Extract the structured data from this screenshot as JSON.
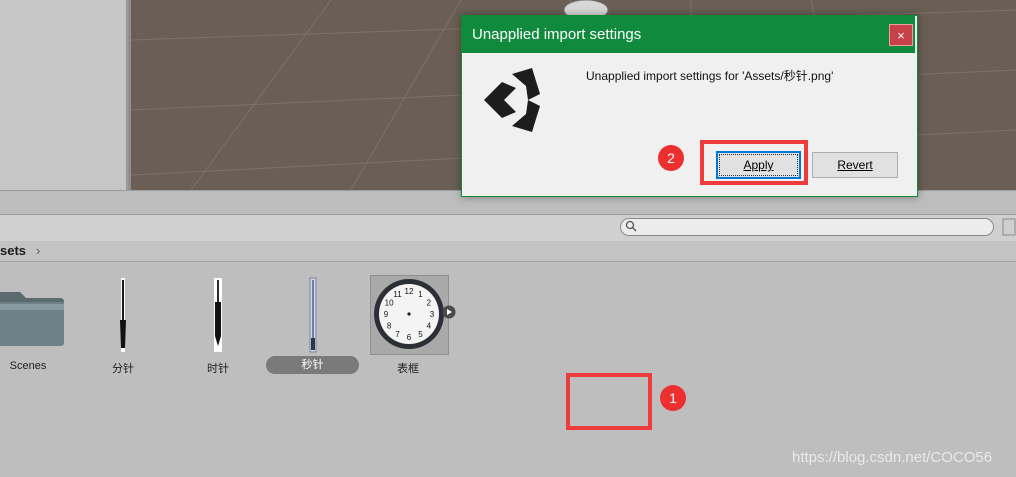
{
  "dialog": {
    "title": "Unapplied import settings",
    "close_glyph": "×",
    "message": "Unapplied import settings for 'Assets/秒针.png'",
    "apply_label": "Apply",
    "revert_label": "Revert"
  },
  "breadcrumb": {
    "text": "sets",
    "arrow": "›"
  },
  "assets": [
    {
      "label": "Scenes",
      "kind": "folder-icon"
    },
    {
      "label": "分针",
      "kind": "minute-hand"
    },
    {
      "label": "时针",
      "kind": "hour-hand"
    },
    {
      "label": "秒针",
      "kind": "second-hand",
      "selected": true
    },
    {
      "label": "表框",
      "kind": "clock-face"
    }
  ],
  "clock_numbers": [
    "12",
    "1",
    "2",
    "3",
    "4",
    "5",
    "6",
    "7",
    "8",
    "9",
    "10",
    "11"
  ],
  "annotations": {
    "badge_1": "1",
    "badge_2": "2"
  },
  "watermark": "https://blog.csdn.net/COCO56",
  "colors": {
    "titlebar": "#108b3d",
    "annotation_red": "#ee3b3b",
    "focus_blue": "#0078d7"
  }
}
